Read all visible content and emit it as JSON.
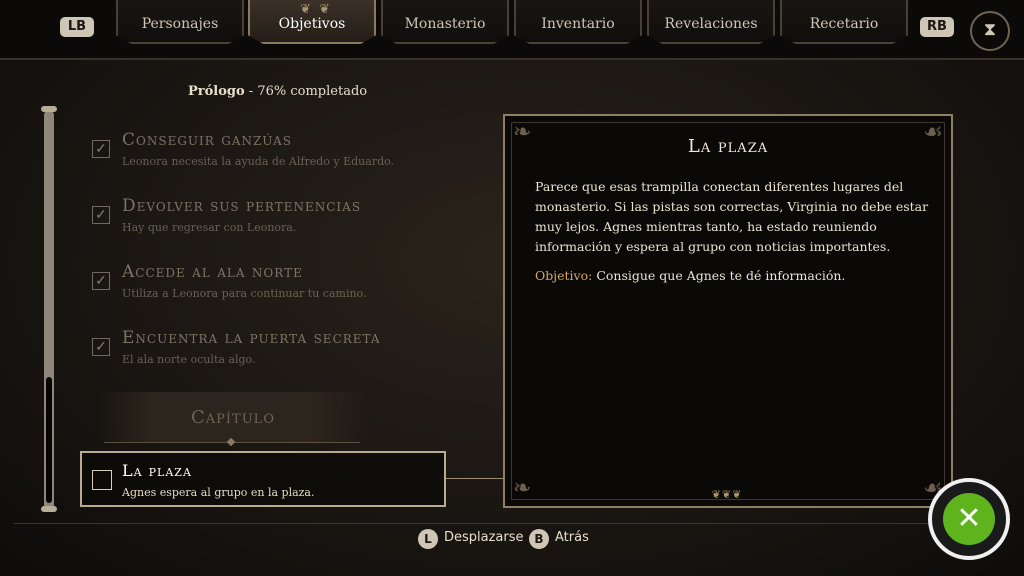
{
  "tabs": {
    "lb": "LB",
    "rb": "RB",
    "items": [
      {
        "label": "Personajes"
      },
      {
        "label": "Objetivos"
      },
      {
        "label": "Monasterio"
      },
      {
        "label": "Inventario"
      },
      {
        "label": "Revelaciones"
      },
      {
        "label": "Recetario"
      }
    ],
    "active_index": 1
  },
  "progress": {
    "chapter": "Prólogo",
    "separator": " - ",
    "text": "76% completado",
    "percent": 76
  },
  "objectives": [
    {
      "title": "Conseguir ganzúas",
      "desc": "Leonora necesita la ayuda de Alfredo y Eduardo.",
      "done": true
    },
    {
      "title": "Devolver sus pertenencias",
      "desc": "Hay que regresar con Leonora.",
      "done": true
    },
    {
      "title": "Accede al ala norte",
      "desc": "Utiliza a Leonora para continuar tu camino.",
      "done": true
    },
    {
      "title": "Encuentra la puerta secreta",
      "desc": "El ala norte oculta algo.",
      "done": true
    }
  ],
  "chapter_header": "Capítulo",
  "selected_objective": {
    "title": "La plaza",
    "desc": "Agnes espera al grupo en la plaza.",
    "done": false
  },
  "detail": {
    "title": "La plaza",
    "body": "Parece que esas trampilla conectan diferentes lugares del monasterio. Si las pistas son correctas, Virginia no debe estar muy lejos. Agnes mientras tanto, ha estado reuniendo información y espera al grupo con noticias importantes.",
    "objective_label": "Objetivo:",
    "objective_text": " Consigue que Agnes te dé información."
  },
  "footer": {
    "scroll_button": "L",
    "scroll_label": "Desplazarse",
    "back_button": "B",
    "back_label": "Atrás"
  },
  "colors": {
    "accent": "#d7a464",
    "xbox_green": "#5fb41e"
  }
}
